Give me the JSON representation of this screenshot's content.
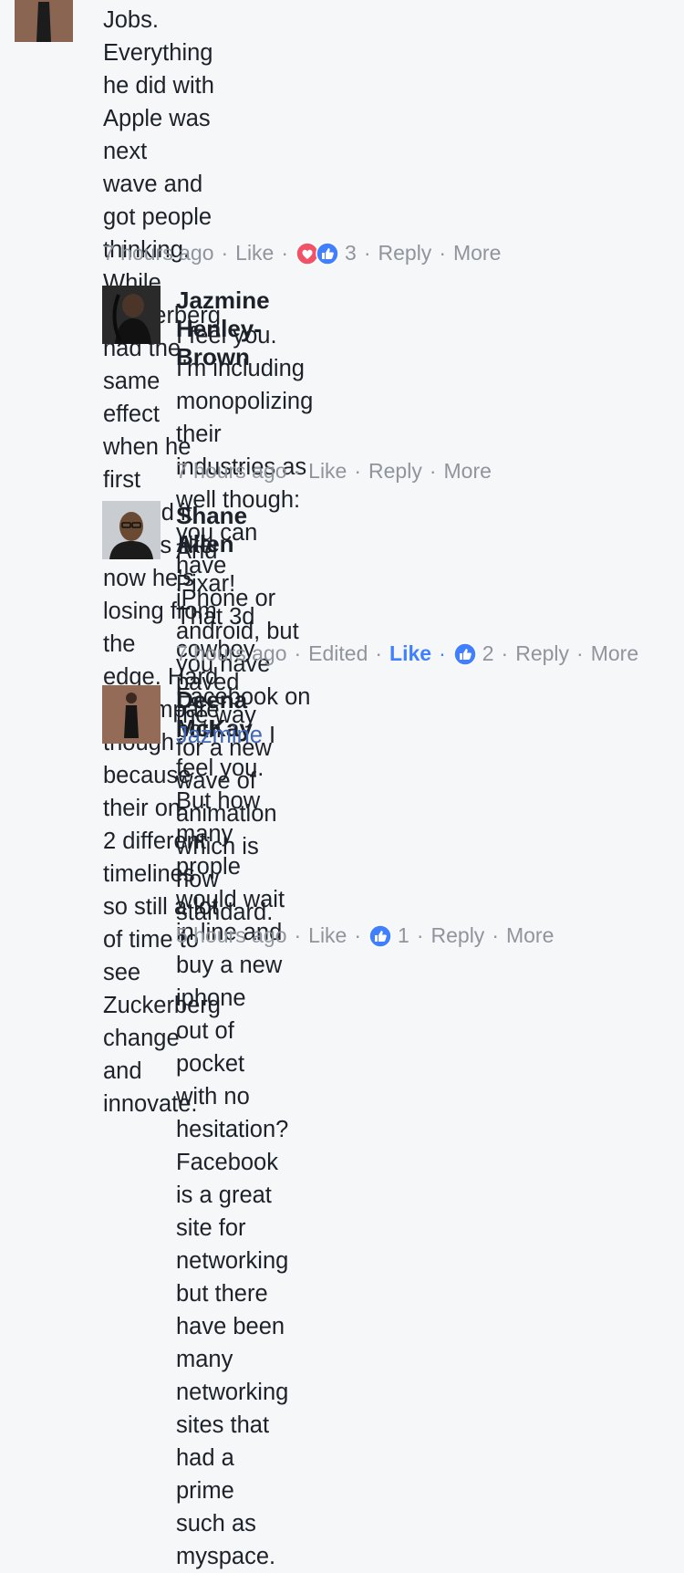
{
  "comments": [
    {
      "text": "Jobs. Everything he did with Apple was next wave and got people thinking. While Zuckerberg had the same effect when he first started it seems like now he's losing from the edge. Hard to compare though because their on 2 different timelines so still a lot of time to see Zuckerberg change and innovate.",
      "lines": [
        "Jobs. Everything he did with Apple was next",
        "wave and got people thinking. While",
        "Zuckerberg had the same effect when he first",
        "started it seems like now he's losing from the",
        "edge. Hard to compare though because their on",
        "2 different timelines so still a lot of time to see",
        "Zuckerberg change and innovate."
      ],
      "time": "7 hours ago",
      "like": "Like",
      "reactions": [
        "love-icon",
        "like-icon"
      ],
      "reaction_count": "3",
      "reply": "Reply",
      "more": "More"
    },
    {
      "author": "Jazmine Henley-Brown",
      "lines": [
        "I feel you. I'm including monopolizing their",
        "industries as well though: you can have",
        "iPhone or android, but you have",
        "Facebook on both"
      ],
      "time": "7 hours ago",
      "like": "Like",
      "reply": "Reply",
      "more": "More"
    },
    {
      "author": "Shane Allen",
      "lines": [
        "And Pixar! That 3d cowboy paved the way",
        "for a new wave of animation which is now",
        "standard."
      ],
      "time": "7 hours ago",
      "edited": "Edited",
      "like": "Like",
      "liked": true,
      "reactions": [
        "like-icon"
      ],
      "reaction_count": "2",
      "reply": "Reply",
      "more": "More"
    },
    {
      "author": "Deena McKay",
      "mention": "Jazmine",
      "first_line_rest": " I feel you. But how many prople",
      "lines": [
        "would wait in line and buy a new iphone",
        "out of pocket with no hesitation?",
        "Facebook is a great site for networking",
        "but there have been many networking",
        "sites that had a prime such as myspace."
      ],
      "time": "5 hours ago",
      "like": "Like",
      "reactions": [
        "like-icon"
      ],
      "reaction_count": "1",
      "reply": "Reply",
      "more": "More"
    }
  ],
  "separator": "·",
  "colors": {
    "background": "#f6f7f9",
    "text": "#1d2129",
    "meta": "#90949c",
    "like_blue": "#4080ff",
    "love_red": "#f25268",
    "mention": "#4267b2"
  }
}
